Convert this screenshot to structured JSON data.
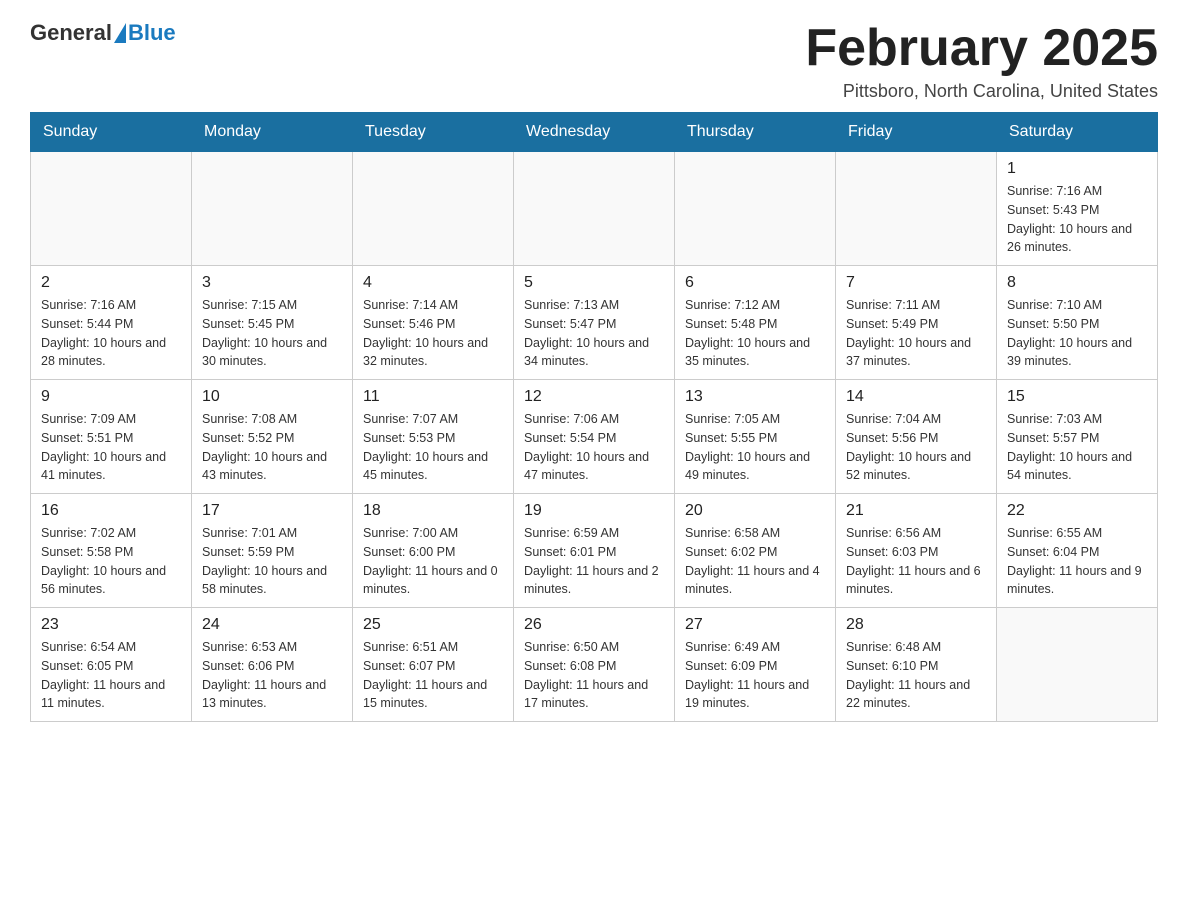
{
  "header": {
    "logo_general": "General",
    "logo_blue": "Blue",
    "month_title": "February 2025",
    "location": "Pittsboro, North Carolina, United States"
  },
  "days_of_week": [
    "Sunday",
    "Monday",
    "Tuesday",
    "Wednesday",
    "Thursday",
    "Friday",
    "Saturday"
  ],
  "weeks": [
    [
      {
        "day": "",
        "sunrise": "",
        "sunset": "",
        "daylight": ""
      },
      {
        "day": "",
        "sunrise": "",
        "sunset": "",
        "daylight": ""
      },
      {
        "day": "",
        "sunrise": "",
        "sunset": "",
        "daylight": ""
      },
      {
        "day": "",
        "sunrise": "",
        "sunset": "",
        "daylight": ""
      },
      {
        "day": "",
        "sunrise": "",
        "sunset": "",
        "daylight": ""
      },
      {
        "day": "",
        "sunrise": "",
        "sunset": "",
        "daylight": ""
      },
      {
        "day": "1",
        "sunrise": "Sunrise: 7:16 AM",
        "sunset": "Sunset: 5:43 PM",
        "daylight": "Daylight: 10 hours and 26 minutes."
      }
    ],
    [
      {
        "day": "2",
        "sunrise": "Sunrise: 7:16 AM",
        "sunset": "Sunset: 5:44 PM",
        "daylight": "Daylight: 10 hours and 28 minutes."
      },
      {
        "day": "3",
        "sunrise": "Sunrise: 7:15 AM",
        "sunset": "Sunset: 5:45 PM",
        "daylight": "Daylight: 10 hours and 30 minutes."
      },
      {
        "day": "4",
        "sunrise": "Sunrise: 7:14 AM",
        "sunset": "Sunset: 5:46 PM",
        "daylight": "Daylight: 10 hours and 32 minutes."
      },
      {
        "day": "5",
        "sunrise": "Sunrise: 7:13 AM",
        "sunset": "Sunset: 5:47 PM",
        "daylight": "Daylight: 10 hours and 34 minutes."
      },
      {
        "day": "6",
        "sunrise": "Sunrise: 7:12 AM",
        "sunset": "Sunset: 5:48 PM",
        "daylight": "Daylight: 10 hours and 35 minutes."
      },
      {
        "day": "7",
        "sunrise": "Sunrise: 7:11 AM",
        "sunset": "Sunset: 5:49 PM",
        "daylight": "Daylight: 10 hours and 37 minutes."
      },
      {
        "day": "8",
        "sunrise": "Sunrise: 7:10 AM",
        "sunset": "Sunset: 5:50 PM",
        "daylight": "Daylight: 10 hours and 39 minutes."
      }
    ],
    [
      {
        "day": "9",
        "sunrise": "Sunrise: 7:09 AM",
        "sunset": "Sunset: 5:51 PM",
        "daylight": "Daylight: 10 hours and 41 minutes."
      },
      {
        "day": "10",
        "sunrise": "Sunrise: 7:08 AM",
        "sunset": "Sunset: 5:52 PM",
        "daylight": "Daylight: 10 hours and 43 minutes."
      },
      {
        "day": "11",
        "sunrise": "Sunrise: 7:07 AM",
        "sunset": "Sunset: 5:53 PM",
        "daylight": "Daylight: 10 hours and 45 minutes."
      },
      {
        "day": "12",
        "sunrise": "Sunrise: 7:06 AM",
        "sunset": "Sunset: 5:54 PM",
        "daylight": "Daylight: 10 hours and 47 minutes."
      },
      {
        "day": "13",
        "sunrise": "Sunrise: 7:05 AM",
        "sunset": "Sunset: 5:55 PM",
        "daylight": "Daylight: 10 hours and 49 minutes."
      },
      {
        "day": "14",
        "sunrise": "Sunrise: 7:04 AM",
        "sunset": "Sunset: 5:56 PM",
        "daylight": "Daylight: 10 hours and 52 minutes."
      },
      {
        "day": "15",
        "sunrise": "Sunrise: 7:03 AM",
        "sunset": "Sunset: 5:57 PM",
        "daylight": "Daylight: 10 hours and 54 minutes."
      }
    ],
    [
      {
        "day": "16",
        "sunrise": "Sunrise: 7:02 AM",
        "sunset": "Sunset: 5:58 PM",
        "daylight": "Daylight: 10 hours and 56 minutes."
      },
      {
        "day": "17",
        "sunrise": "Sunrise: 7:01 AM",
        "sunset": "Sunset: 5:59 PM",
        "daylight": "Daylight: 10 hours and 58 minutes."
      },
      {
        "day": "18",
        "sunrise": "Sunrise: 7:00 AM",
        "sunset": "Sunset: 6:00 PM",
        "daylight": "Daylight: 11 hours and 0 minutes."
      },
      {
        "day": "19",
        "sunrise": "Sunrise: 6:59 AM",
        "sunset": "Sunset: 6:01 PM",
        "daylight": "Daylight: 11 hours and 2 minutes."
      },
      {
        "day": "20",
        "sunrise": "Sunrise: 6:58 AM",
        "sunset": "Sunset: 6:02 PM",
        "daylight": "Daylight: 11 hours and 4 minutes."
      },
      {
        "day": "21",
        "sunrise": "Sunrise: 6:56 AM",
        "sunset": "Sunset: 6:03 PM",
        "daylight": "Daylight: 11 hours and 6 minutes."
      },
      {
        "day": "22",
        "sunrise": "Sunrise: 6:55 AM",
        "sunset": "Sunset: 6:04 PM",
        "daylight": "Daylight: 11 hours and 9 minutes."
      }
    ],
    [
      {
        "day": "23",
        "sunrise": "Sunrise: 6:54 AM",
        "sunset": "Sunset: 6:05 PM",
        "daylight": "Daylight: 11 hours and 11 minutes."
      },
      {
        "day": "24",
        "sunrise": "Sunrise: 6:53 AM",
        "sunset": "Sunset: 6:06 PM",
        "daylight": "Daylight: 11 hours and 13 minutes."
      },
      {
        "day": "25",
        "sunrise": "Sunrise: 6:51 AM",
        "sunset": "Sunset: 6:07 PM",
        "daylight": "Daylight: 11 hours and 15 minutes."
      },
      {
        "day": "26",
        "sunrise": "Sunrise: 6:50 AM",
        "sunset": "Sunset: 6:08 PM",
        "daylight": "Daylight: 11 hours and 17 minutes."
      },
      {
        "day": "27",
        "sunrise": "Sunrise: 6:49 AM",
        "sunset": "Sunset: 6:09 PM",
        "daylight": "Daylight: 11 hours and 19 minutes."
      },
      {
        "day": "28",
        "sunrise": "Sunrise: 6:48 AM",
        "sunset": "Sunset: 6:10 PM",
        "daylight": "Daylight: 11 hours and 22 minutes."
      },
      {
        "day": "",
        "sunrise": "",
        "sunset": "",
        "daylight": ""
      }
    ]
  ]
}
